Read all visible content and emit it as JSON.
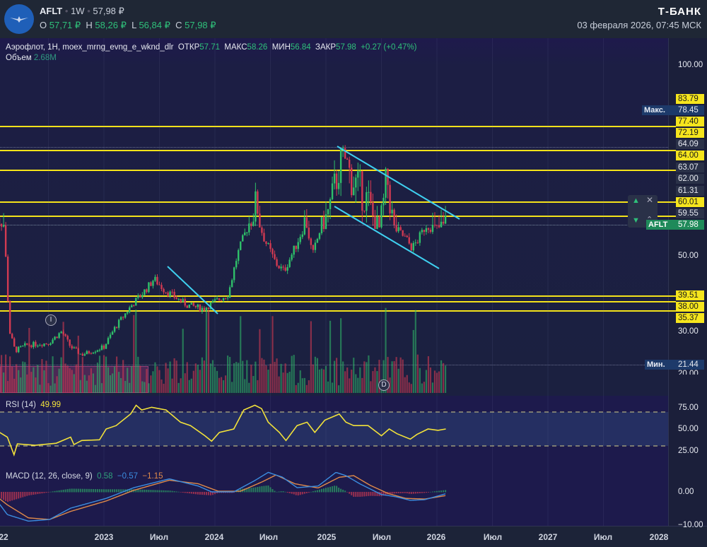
{
  "header": {
    "ticker": "AFLT",
    "interval": "1W",
    "price": "57,98 ₽",
    "o_label": "O",
    "o": "57,71 ₽",
    "h_label": "H",
    "h": "58,26 ₽",
    "l_label": "L",
    "l": "56,84 ₽",
    "c_label": "C",
    "c": "57,98 ₽",
    "brand": "Т‑БАНК",
    "datetime": "03 февраля 2026, 07:45 МСК"
  },
  "legend": {
    "title": "Аэрофлот, 1H, moex_mrng_evng_e_wknd_dlr",
    "open_label": "ОТКР",
    "open": "57.71",
    "high_label": "МАКС",
    "high": "58.26",
    "low_label": "МИН",
    "low": "56.84",
    "close_label": "ЗАКР",
    "close": "57.98",
    "change": "+0.27 (+0.47%)",
    "volume_label": "Объем",
    "volume": "2.68M"
  },
  "axis": {
    "price_labels": [
      "100.00",
      "78.45",
      "64.09",
      "63.07",
      "62.00",
      "61.31",
      "59.55",
      "50.00",
      "30.00",
      "20.00"
    ],
    "max_label": "Макс.",
    "min_label": "Мин.",
    "min_value": "21.44",
    "last_tag": "AFLT",
    "last_value": "57.98",
    "levels": [
      "83.79",
      "77.40",
      "72.19",
      "64.00",
      "60.01",
      "39.51",
      "38.00",
      "35.37"
    ],
    "rsi_ticks": [
      "75.00",
      "50.00",
      "25.00"
    ],
    "macd_ticks": [
      "0.00",
      "−10.00"
    ]
  },
  "x_ticks": [
    "22",
    "2023",
    "Июл",
    "2024",
    "Июл",
    "2025",
    "Июл",
    "2026",
    "Июл",
    "2027",
    "Июл",
    "2028"
  ],
  "markers": {
    "event_i": "I",
    "event_d": "D"
  },
  "rsi": {
    "label": "RSI (14)",
    "value": "49.99"
  },
  "macd": {
    "label": "MACD (12, 26, close, 9)",
    "hist": "0.58",
    "macd": "−0.57",
    "signal": "−1.15"
  },
  "colors": {
    "up": "#2fbf6a",
    "down": "#d23a52",
    "level": "#f4e21a",
    "trend": "#3fd0f0",
    "rsi": "#f2e23a",
    "macd": "#3b8de0",
    "signal": "#e08a4a"
  },
  "chart_data": {
    "type": "candlestick",
    "x_unit": "year",
    "price_keypoints": [
      [
        2022.0,
        60
      ],
      [
        2022.1,
        58
      ],
      [
        2022.15,
        30
      ],
      [
        2022.2,
        25
      ],
      [
        2022.3,
        26.5
      ],
      [
        2022.5,
        27
      ],
      [
        2022.62,
        30
      ],
      [
        2022.7,
        26
      ],
      [
        2022.8,
        24
      ],
      [
        2022.9,
        25
      ],
      [
        2023.0,
        26
      ],
      [
        2023.1,
        31
      ],
      [
        2023.25,
        37
      ],
      [
        2023.4,
        42
      ],
      [
        2023.45,
        44
      ],
      [
        2023.55,
        41
      ],
      [
        2023.75,
        37
      ],
      [
        2023.9,
        36
      ],
      [
        2024.0,
        38
      ],
      [
        2024.12,
        40
      ],
      [
        2024.2,
        50
      ],
      [
        2024.3,
        58
      ],
      [
        2024.38,
        60
      ],
      [
        2024.45,
        54
      ],
      [
        2024.55,
        48
      ],
      [
        2024.62,
        46
      ],
      [
        2024.72,
        52
      ],
      [
        2024.82,
        59
      ],
      [
        2024.88,
        50
      ],
      [
        2024.95,
        57
      ],
      [
        2025.05,
        60
      ],
      [
        2025.15,
        64
      ],
      [
        2025.22,
        62
      ],
      [
        2025.3,
        61
      ],
      [
        2025.38,
        60
      ],
      [
        2025.48,
        57
      ],
      [
        2025.55,
        62
      ],
      [
        2025.62,
        57
      ],
      [
        2025.7,
        55
      ],
      [
        2025.78,
        52
      ],
      [
        2025.85,
        55
      ],
      [
        2025.9,
        58
      ],
      [
        2026.0,
        57
      ],
      [
        2026.08,
        57.98
      ]
    ],
    "rsi_points": [
      [
        2022.06,
        45
      ],
      [
        2022.13,
        38
      ],
      [
        2022.19,
        12
      ],
      [
        2022.22,
        28
      ],
      [
        2022.38,
        26
      ],
      [
        2022.57,
        29
      ],
      [
        2022.7,
        38
      ],
      [
        2022.73,
        27
      ],
      [
        2022.8,
        33
      ],
      [
        2022.96,
        34
      ],
      [
        2023.02,
        50
      ],
      [
        2023.11,
        55
      ],
      [
        2023.24,
        72
      ],
      [
        2023.29,
        85
      ],
      [
        2023.34,
        78
      ],
      [
        2023.43,
        82
      ],
      [
        2023.56,
        78
      ],
      [
        2023.69,
        60
      ],
      [
        2023.78,
        55
      ],
      [
        2023.91,
        40
      ],
      [
        2023.97,
        32
      ],
      [
        2024.04,
        45
      ],
      [
        2024.17,
        50
      ],
      [
        2024.26,
        78
      ],
      [
        2024.36,
        85
      ],
      [
        2024.42,
        80
      ],
      [
        2024.48,
        60
      ],
      [
        2024.58,
        45
      ],
      [
        2024.64,
        33
      ],
      [
        2024.74,
        55
      ],
      [
        2024.83,
        60
      ],
      [
        2024.9,
        45
      ],
      [
        2024.99,
        63
      ],
      [
        2025.12,
        72
      ],
      [
        2025.18,
        60
      ],
      [
        2025.25,
        55
      ],
      [
        2025.38,
        55
      ],
      [
        2025.5,
        40
      ],
      [
        2025.57,
        50
      ],
      [
        2025.64,
        43
      ],
      [
        2025.76,
        35
      ],
      [
        2025.82,
        42
      ],
      [
        2025.92,
        50
      ],
      [
        2026.01,
        48
      ],
      [
        2026.08,
        49.99
      ]
    ],
    "macd_points": [
      [
        2022.0,
        -1
      ],
      [
        2022.13,
        -7
      ],
      [
        2022.32,
        -9
      ],
      [
        2022.51,
        -8.5
      ],
      [
        2022.7,
        -5
      ],
      [
        2023.02,
        -2
      ],
      [
        2023.27,
        1.3
      ],
      [
        2023.59,
        4
      ],
      [
        2023.85,
        1.8
      ],
      [
        2023.97,
        0
      ],
      [
        2024.17,
        0
      ],
      [
        2024.36,
        3.5
      ],
      [
        2024.48,
        6
      ],
      [
        2024.61,
        4.5
      ],
      [
        2024.74,
        1.3
      ],
      [
        2024.93,
        1.8
      ],
      [
        2025.09,
        6
      ],
      [
        2025.18,
        5
      ],
      [
        2025.31,
        2.4
      ],
      [
        2025.5,
        -0.8
      ],
      [
        2025.63,
        -1.5
      ],
      [
        2025.76,
        -2.6
      ],
      [
        2025.89,
        -2.4
      ],
      [
        2026.08,
        -0.57
      ]
    ],
    "signal_points": [
      [
        2022.0,
        -0.5
      ],
      [
        2022.13,
        -4
      ],
      [
        2022.32,
        -8
      ],
      [
        2022.51,
        -8.5
      ],
      [
        2022.7,
        -6
      ],
      [
        2023.02,
        -2.8
      ],
      [
        2023.27,
        0.5
      ],
      [
        2023.59,
        3.6
      ],
      [
        2023.85,
        2.5
      ],
      [
        2024.03,
        0.2
      ],
      [
        2024.23,
        0.2
      ],
      [
        2024.42,
        3
      ],
      [
        2024.55,
        5.2
      ],
      [
        2024.72,
        2.5
      ],
      [
        2024.93,
        1.2
      ],
      [
        2025.12,
        4.5
      ],
      [
        2025.25,
        5
      ],
      [
        2025.4,
        2
      ],
      [
        2025.56,
        -0.5
      ],
      [
        2025.72,
        -2
      ],
      [
        2025.89,
        -2.2
      ],
      [
        2026.08,
        -1.15
      ]
    ],
    "ylim": [
      20,
      100
    ],
    "rsi_ylim": [
      0,
      100
    ],
    "macd_ylim": [
      -10,
      7
    ]
  }
}
